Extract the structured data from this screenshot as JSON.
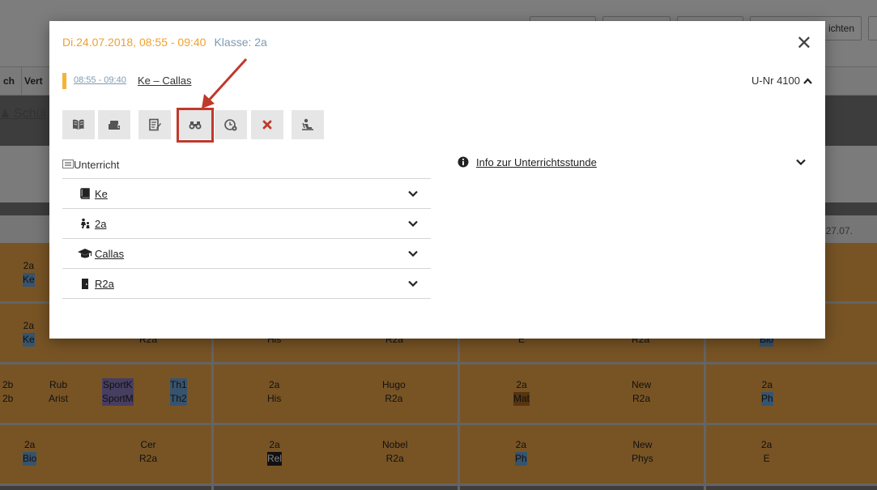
{
  "background": {
    "top_button_text": "ichten",
    "nav_cells": [
      "ch",
      "Vert"
    ],
    "schueler_text": "Schül",
    "date_text": "27.07.",
    "rows": [
      {
        "cells": [
          {
            "t": "2a",
            "b": "Ke"
          }
        ]
      },
      {
        "cells": [
          {
            "t": "2a",
            "b": "Ke"
          },
          {
            "t": "",
            "b": "R2a"
          },
          {
            "t": "",
            "b": "His"
          },
          {
            "t": "",
            "b": "R2a"
          },
          {
            "t": "",
            "b": "E"
          },
          {
            "t": "",
            "b": "R2a"
          },
          {
            "t": "",
            "b": "Bio"
          }
        ]
      },
      {
        "cells": [
          {
            "t": "2b",
            "b": "2b"
          },
          {
            "t": "Rub",
            "b": "Arist"
          },
          {
            "t": "SportK",
            "b": "SportM"
          },
          {
            "t": "Th1",
            "b": "Th2"
          },
          {
            "t": "2a",
            "b": "His"
          },
          {
            "t": "Hugo",
            "b": "R2a"
          },
          {
            "t": "2a",
            "b": "Mat"
          },
          {
            "t": "New",
            "b": "R2a"
          },
          {
            "t": "2a",
            "b": "Ph"
          }
        ]
      },
      {
        "cells": [
          {
            "t": "2a",
            "b": "Bio"
          },
          {
            "t": "Cer",
            "b": "R2a"
          },
          {
            "t": "2a",
            "b": "Rel"
          },
          {
            "t": "Nobel",
            "b": "R2a"
          },
          {
            "t": "2a",
            "b": "Ph"
          },
          {
            "t": "New",
            "b": "Phys"
          },
          {
            "t": "2a",
            "b": "E"
          }
        ]
      }
    ]
  },
  "modal": {
    "date_time": "Di.24.07.2018, 08:55 - 09:40",
    "klasse": "Klasse: 2a",
    "close_icon": "close-icon",
    "lesson": {
      "time": "08:55 - 09:40",
      "name": "Ke – Callas",
      "unr": "U-Nr 4100"
    },
    "toolbar": [
      {
        "icon": "open-book-icon"
      },
      {
        "icon": "homework-icon"
      },
      {
        "icon": "notes-icon"
      },
      {
        "icon": "binoculars-icon"
      },
      {
        "icon": "clock-settings-icon"
      },
      {
        "icon": "cancel-icon",
        "color": "#c0392b"
      },
      {
        "icon": "seat-person-icon"
      }
    ],
    "list_header": "Unterricht",
    "list_items": [
      {
        "icon": "book-icon",
        "label": "Ke"
      },
      {
        "icon": "class-group-icon",
        "label": "2a"
      },
      {
        "icon": "graduation-cap-icon",
        "label": "Callas"
      },
      {
        "icon": "door-icon",
        "label": "R2a"
      }
    ],
    "info_label": "Info zur Unterrichtsstunde",
    "highlight_color": "#c0392b"
  }
}
